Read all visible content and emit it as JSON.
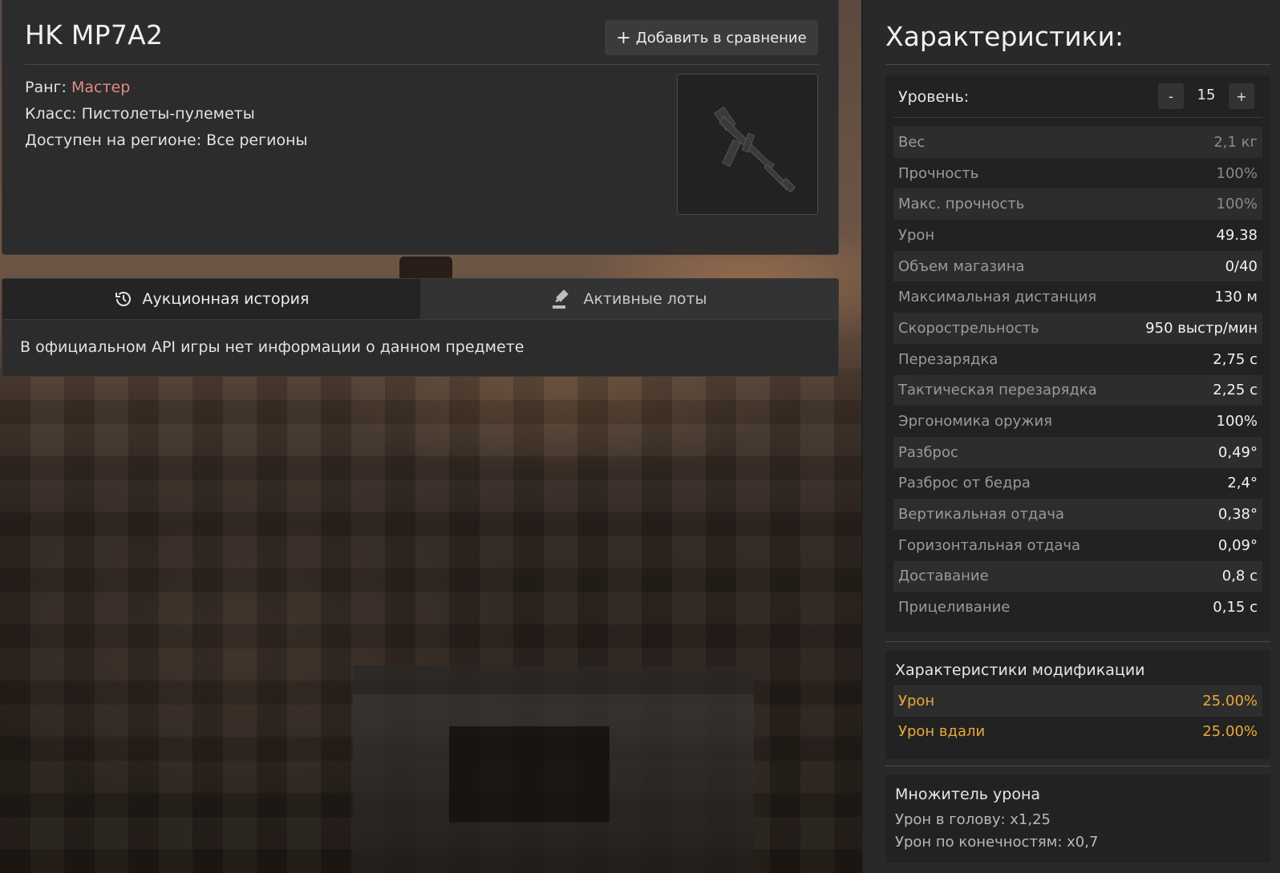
{
  "item": {
    "title": "HK MP7A2",
    "compare_label": "Добавить в сравнение",
    "rank_label": "Ранг:",
    "rank_value": "Мастер",
    "class_line": "Класс: Пистолеты-пулеметы",
    "region_line": "Доступен на регионе: Все регионы",
    "rank_color": "#e08b8b"
  },
  "tabs": {
    "history": "Аукционная история",
    "active_lots": "Активные лоты",
    "message": "В официальном API игры нет информации о данном предмете"
  },
  "characteristics": {
    "title": "Характеристики:",
    "level_label": "Уровень:",
    "level_value": "15",
    "minus": "-",
    "plus": "+",
    "stats": [
      {
        "label": "Вес",
        "value": "2,1 кг",
        "dim": true
      },
      {
        "label": "Прочность",
        "value": "100%",
        "dim": true
      },
      {
        "label": "Макс. прочность",
        "value": "100%",
        "dim": true
      },
      {
        "label": "Урон",
        "value": "49.38",
        "dim": false
      },
      {
        "label": "Объем магазина",
        "value": "0/40",
        "dim": false
      },
      {
        "label": "Максимальная дистанция",
        "value": "130 м",
        "dim": false
      },
      {
        "label": "Скорострельность",
        "value": "950 выстр/мин",
        "dim": false
      },
      {
        "label": "Перезарядка",
        "value": "2,75 с",
        "dim": false
      },
      {
        "label": "Тактическая перезарядка",
        "value": "2,25 с",
        "dim": false
      },
      {
        "label": "Эргономика оружия",
        "value": "100%",
        "dim": false
      },
      {
        "label": "Разброс",
        "value": "0,49°",
        "dim": false
      },
      {
        "label": "Разброс от бедра",
        "value": "2,4°",
        "dim": false
      },
      {
        "label": "Вертикальная отдача",
        "value": "0,38°",
        "dim": false
      },
      {
        "label": "Горизонтальная отдача",
        "value": "0,09°",
        "dim": false
      },
      {
        "label": "Доставание",
        "value": "0,8 с",
        "dim": false
      },
      {
        "label": "Прицеливание",
        "value": "0,15 с",
        "dim": false
      }
    ]
  },
  "modification": {
    "title": "Характеристики модификации",
    "accent_color": "#e9a83a",
    "rows": [
      {
        "label": "Урон",
        "value": "25.00%"
      },
      {
        "label": "Урон вдали",
        "value": "25.00%"
      }
    ]
  },
  "multiplier": {
    "title": "Множитель урона",
    "head": "Урон в голову: x1,25",
    "limbs": "Урон по конечностям: x0,7"
  },
  "icons": {
    "history_icon": "history-icon",
    "gavel_icon": "gavel-icon",
    "plus_icon": "plus-icon",
    "weapon_image": "weapon-image"
  }
}
